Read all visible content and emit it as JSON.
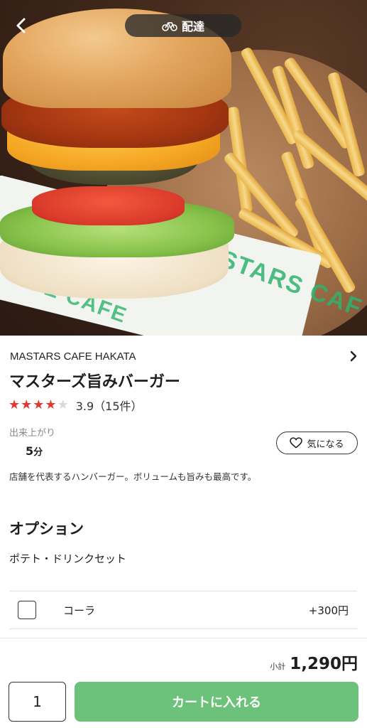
{
  "header": {
    "delivery_mode": "配達",
    "back_icon": "chevron-left-icon",
    "bike_icon": "bicycle-icon"
  },
  "hero": {
    "paper_print_1": "MASTARS CAF",
    "paper_print_2": "FE CAFE"
  },
  "shop": {
    "name": "MASTARS CAFE HAKATA",
    "chevron_icon": "chevron-right-icon"
  },
  "product": {
    "title": "マスターズ旨みバーガー",
    "rating": 3.9,
    "stars_filled": 4,
    "stars_total": 5,
    "rating_text": "3.9（15件）",
    "prep_label": "出来上がり",
    "prep_value": "5",
    "prep_unit": "分",
    "favorite_label": "気になる",
    "description": "店舗を代表するハンバーガー。ボリュームも旨みも最高です。"
  },
  "options": {
    "section_title": "オプション",
    "group_title": "ポテト・ドリンクセット",
    "items": [
      {
        "name": "コーラ",
        "price": "+300円",
        "checked": false
      }
    ]
  },
  "footer": {
    "subtotal_label": "小計",
    "subtotal_value": "1,290円",
    "quantity": "1",
    "cart_button": "カートに入れる"
  },
  "colors": {
    "star_filled": "#e0392f",
    "star_empty": "#d9d9d9",
    "cart_button": "#6cc27a",
    "pill_bg": "#2b2b2b"
  }
}
